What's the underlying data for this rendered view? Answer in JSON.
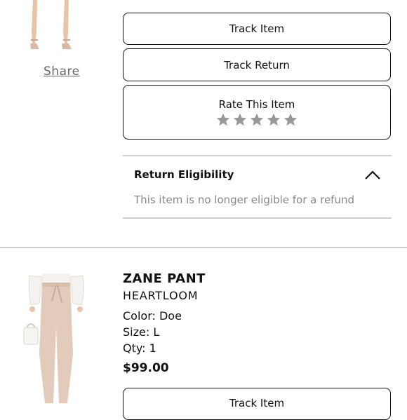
{
  "order_item_1": {
    "share_label": "Share",
    "track_item_label": "Track Item",
    "track_return_label": "Track Return",
    "rate_label": "Rate This Item",
    "rating": {
      "max": 5,
      "value": 0
    },
    "return_eligibility": {
      "title": "Return Eligibility",
      "message": "This item is no longer eligible for a refund",
      "expanded": true
    }
  },
  "order_item_2": {
    "name": "ZANE PANT",
    "brand": "HEARTLOOM",
    "color": "Color: Doe",
    "size": "Size: L",
    "qty": "Qty: 1",
    "price": "$99.00",
    "track_item_label": "Track Item"
  },
  "colors": {
    "text": "#111111",
    "muted": "#888888",
    "star": "#999999",
    "divider": "#cfcfcf"
  }
}
